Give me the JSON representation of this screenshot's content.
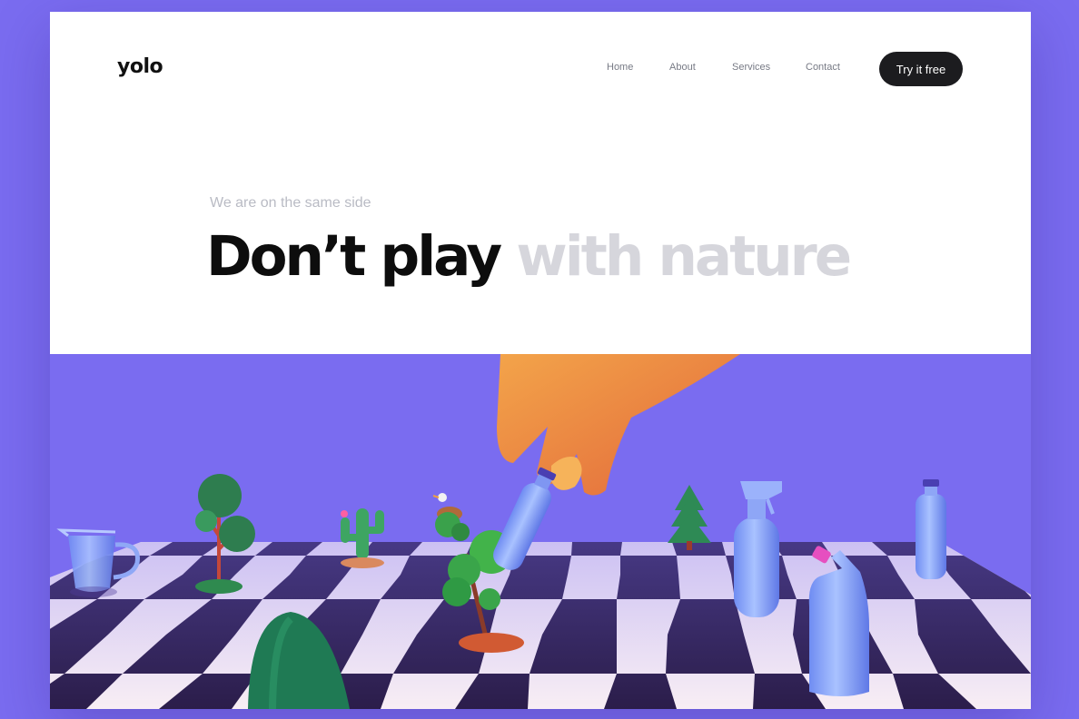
{
  "brand": {
    "logo": "yolo"
  },
  "nav": {
    "items": [
      {
        "label": "Home"
      },
      {
        "label": "About"
      },
      {
        "label": "Services"
      },
      {
        "label": "Contact"
      }
    ],
    "cta_label": "Try it free"
  },
  "hero": {
    "eyebrow": "We are on the same side",
    "headline_dark": "Don’t play",
    "headline_light": "with nature"
  },
  "illustration": {
    "subject": "hand moving a plastic bottle across a chessboard of plants and plastic containers"
  },
  "colors": {
    "background": "#7a6cf0",
    "scene_sky": "#7a6cf0",
    "button": "#1c1c1f",
    "headline_dark": "#0d0d0d",
    "headline_light": "#d6d6dc",
    "board_dark": "#2b1d4a",
    "board_light": "#f8eef4"
  }
}
